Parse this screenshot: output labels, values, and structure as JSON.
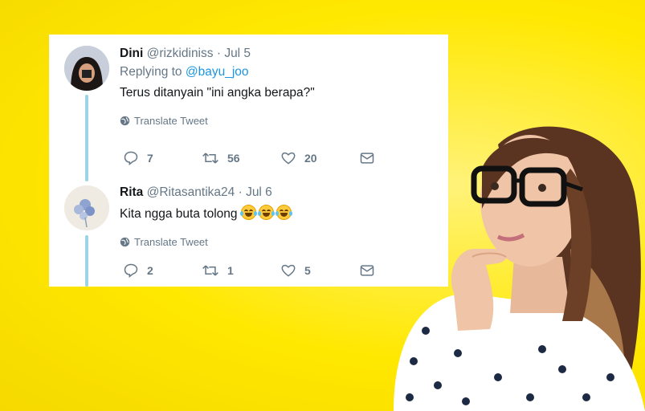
{
  "colors": {
    "background": "#ffe800",
    "link": "#1b95e0",
    "muted": "#657786",
    "thread": "#9ed3e6"
  },
  "tweets": [
    {
      "name": "Dini",
      "handle": "@rizkidiniss",
      "date": "Jul 5",
      "replying_prefix": "Replying to",
      "replying_handle": "@bayu_joo",
      "text": "Terus ditanyain \"ini angka berapa?\"",
      "translate": "Translate Tweet",
      "replies": "7",
      "retweets": "56",
      "likes": "20",
      "icons": [
        "reply-icon",
        "retweet-icon",
        "like-icon",
        "message-icon",
        "globe-icon"
      ]
    },
    {
      "name": "Rita",
      "handle": "@Ritasantika24",
      "date": "Jul 6",
      "text": "Kita ngga buta tolong",
      "emoji_count": 3,
      "translate": "Translate Tweet",
      "replies": "2",
      "retweets": "1",
      "likes": "5",
      "icons": [
        "reply-icon",
        "retweet-icon",
        "like-icon",
        "message-icon",
        "globe-icon"
      ]
    }
  ],
  "sep": "·"
}
